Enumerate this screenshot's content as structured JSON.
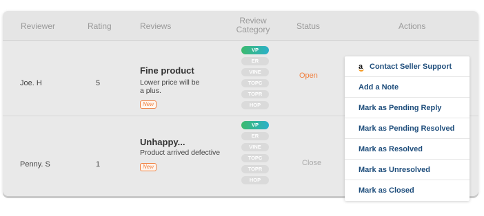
{
  "table": {
    "headers": {
      "reviewer": "Reviewer",
      "rating": "Rating",
      "reviews": "Reviews",
      "category_line1": "Review",
      "category_line2": "Category",
      "status": "Status",
      "actions": "Actions"
    },
    "category_options": [
      "VP",
      "ER",
      "VINE",
      "TOPC",
      "TOPR",
      "HOP"
    ],
    "rows": [
      {
        "reviewer": "Joe. H",
        "rating": "5",
        "review_title": "Fine product",
        "review_text_line1": "Lower price will be",
        "review_text_line2": "a plus.",
        "badge": "New",
        "active_category": "VP",
        "status": "Open"
      },
      {
        "reviewer": "Penny. S",
        "rating": "1",
        "review_title": "Unhappy...",
        "review_text_line1": "Product arrived defective",
        "review_text_line2": "",
        "badge": "New",
        "active_category": "VP",
        "status": "Close"
      }
    ]
  },
  "actions_menu": {
    "items": [
      {
        "label": "Contact Seller Support",
        "icon": "amazon-logo-icon"
      },
      {
        "label": "Add a Note"
      },
      {
        "label": "Mark as Pending Reply"
      },
      {
        "label": "Mark as Pending Resolved"
      },
      {
        "label": "Mark as Resolved"
      },
      {
        "label": "Mark as Unresolved"
      },
      {
        "label": "Mark as Closed"
      }
    ]
  },
  "colors": {
    "status_open": "#f08040",
    "status_close": "#aaaaaa",
    "action_link": "#1f4e7c",
    "active_category_start": "#3cba6e",
    "active_category_end": "#2bb0c9",
    "new_badge": "#f08040"
  }
}
